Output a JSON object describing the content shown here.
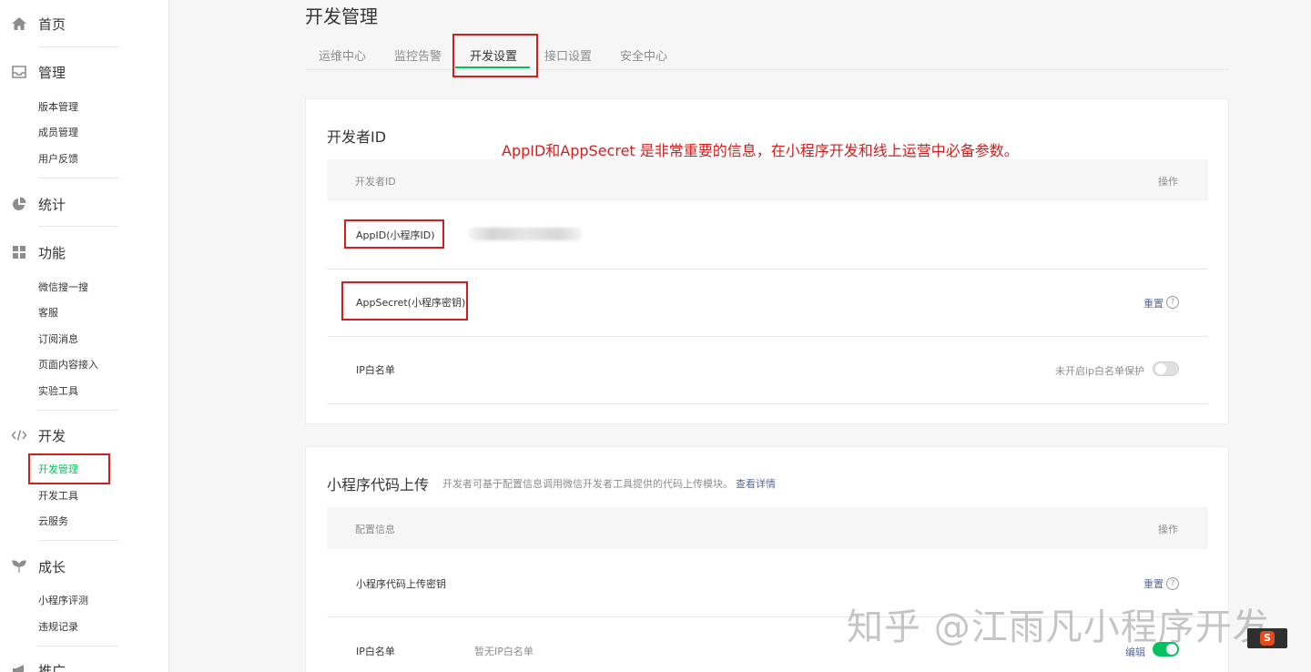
{
  "sidebar": {
    "home": "首页",
    "manage": {
      "title": "管理",
      "items": [
        "版本管理",
        "成员管理",
        "用户反馈"
      ]
    },
    "stats": {
      "title": "统计"
    },
    "features": {
      "title": "功能",
      "items": [
        "微信搜一搜",
        "客服",
        "订阅消息",
        "页面内容接入",
        "实验工具"
      ]
    },
    "dev": {
      "title": "开发",
      "items": [
        "开发管理",
        "开发工具",
        "云服务"
      ]
    },
    "growth": {
      "title": "成长",
      "items": [
        "小程序评测",
        "违规记录"
      ]
    },
    "promote": {
      "title": "推广"
    }
  },
  "page_title": "开发管理",
  "tabs": [
    "运维中心",
    "监控告警",
    "开发设置",
    "接口设置",
    "安全中心"
  ],
  "annotation": "AppID和AppSecret 是非常重要的信息，在小程序开发和线上运营中必备参数。",
  "dev_id_card": {
    "title": "开发者ID",
    "col_name": "开发者ID",
    "col_action": "操作",
    "appid_label": "AppID(小程序ID)",
    "secret_label": "AppSecret(小程序密钥)",
    "secret_action": "重置",
    "ip_label": "IP白名单",
    "ip_status": "未开启ip白名单保护"
  },
  "upload_card": {
    "title": "小程序代码上传",
    "desc": "开发者可基于配置信息调用微信开发者工具提供的代码上传模块。",
    "desc_link": "查看详情",
    "col_name": "配置信息",
    "col_action": "操作",
    "key_label": "小程序代码上传密钥",
    "key_action": "重置",
    "ip_label": "IP白名单",
    "ip_value": "暂无IP白名单",
    "ip_action": "编辑"
  },
  "watermark": "知乎 @江雨凡小程序开发",
  "colors": {
    "accent": "#07c160",
    "annotation": "#d11f1f",
    "link": "#576b95"
  }
}
